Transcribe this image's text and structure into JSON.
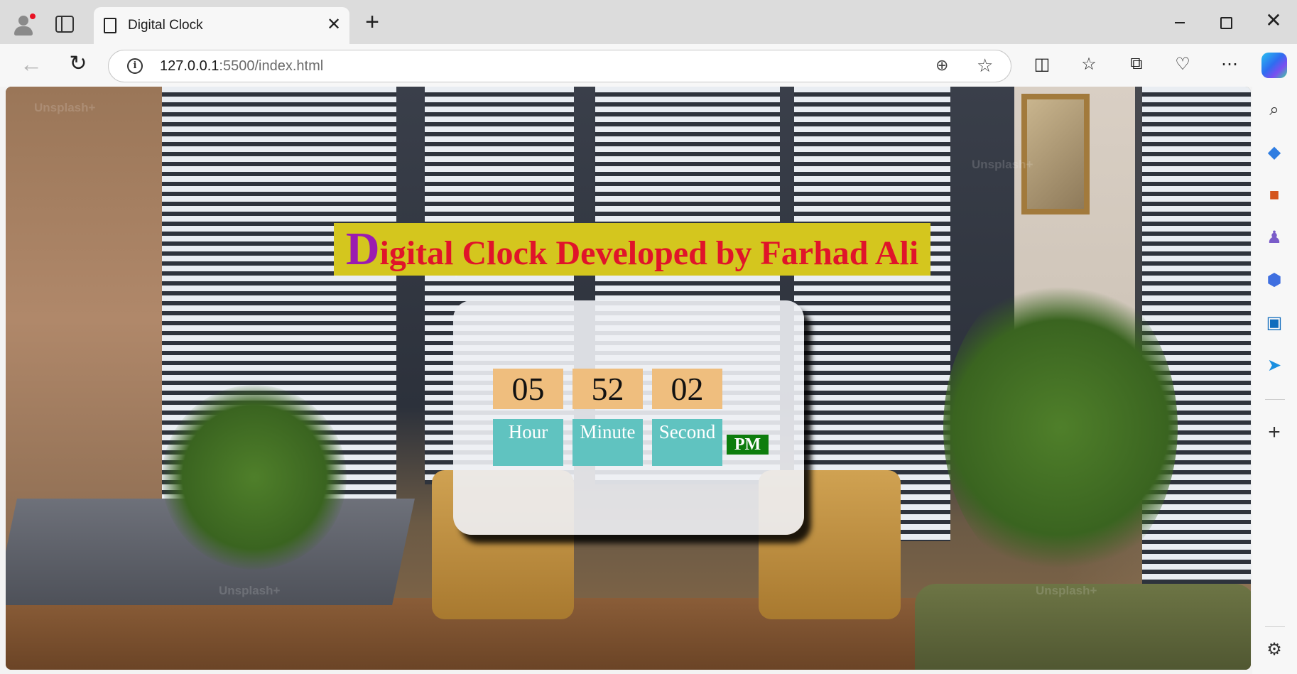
{
  "browser": {
    "tab_title": "Digital Clock",
    "url_host": "127.0.0.1",
    "url_rest": ":5500/index.html",
    "icons": {
      "profile": "profile-icon",
      "tabs": "tab-actions-icon",
      "page": "page-icon",
      "close": "close-icon",
      "new_tab": "plus-icon",
      "back": "back-arrow-icon",
      "refresh": "refresh-icon",
      "info": "info-icon",
      "zoom": "zoom-icon",
      "favorite": "star-icon",
      "split": "split-screen-icon",
      "favorites": "favorites-icon",
      "collections": "collections-icon",
      "browser_essentials": "heart-pulse-icon",
      "more": "more-icon",
      "copilot": "copilot-icon"
    }
  },
  "sidebar": {
    "icons": [
      "search-icon",
      "shopping-tag-icon",
      "toolbox-icon",
      "games-icon",
      "microsoft365-icon",
      "outlook-icon",
      "send-icon",
      "add-icon",
      "settings-icon"
    ]
  },
  "page": {
    "heading_first": "D",
    "heading_rest": "igital Clock Developed by Farhad Ali",
    "watermark": "Unsplash+",
    "clock": {
      "hour": "05",
      "minute": "52",
      "second": "02",
      "hour_label": "Hour",
      "minute_label": "Minute",
      "second_label": "Second",
      "ampm": "PM"
    }
  },
  "colors": {
    "heading_bg": "#d4c61e",
    "heading_first": "#9b1bb0",
    "heading_text": "#e0142a",
    "digit_bg": "#efbe7e",
    "label_bg": "#60c3c0",
    "ampm_bg": "#0d7d0d"
  }
}
